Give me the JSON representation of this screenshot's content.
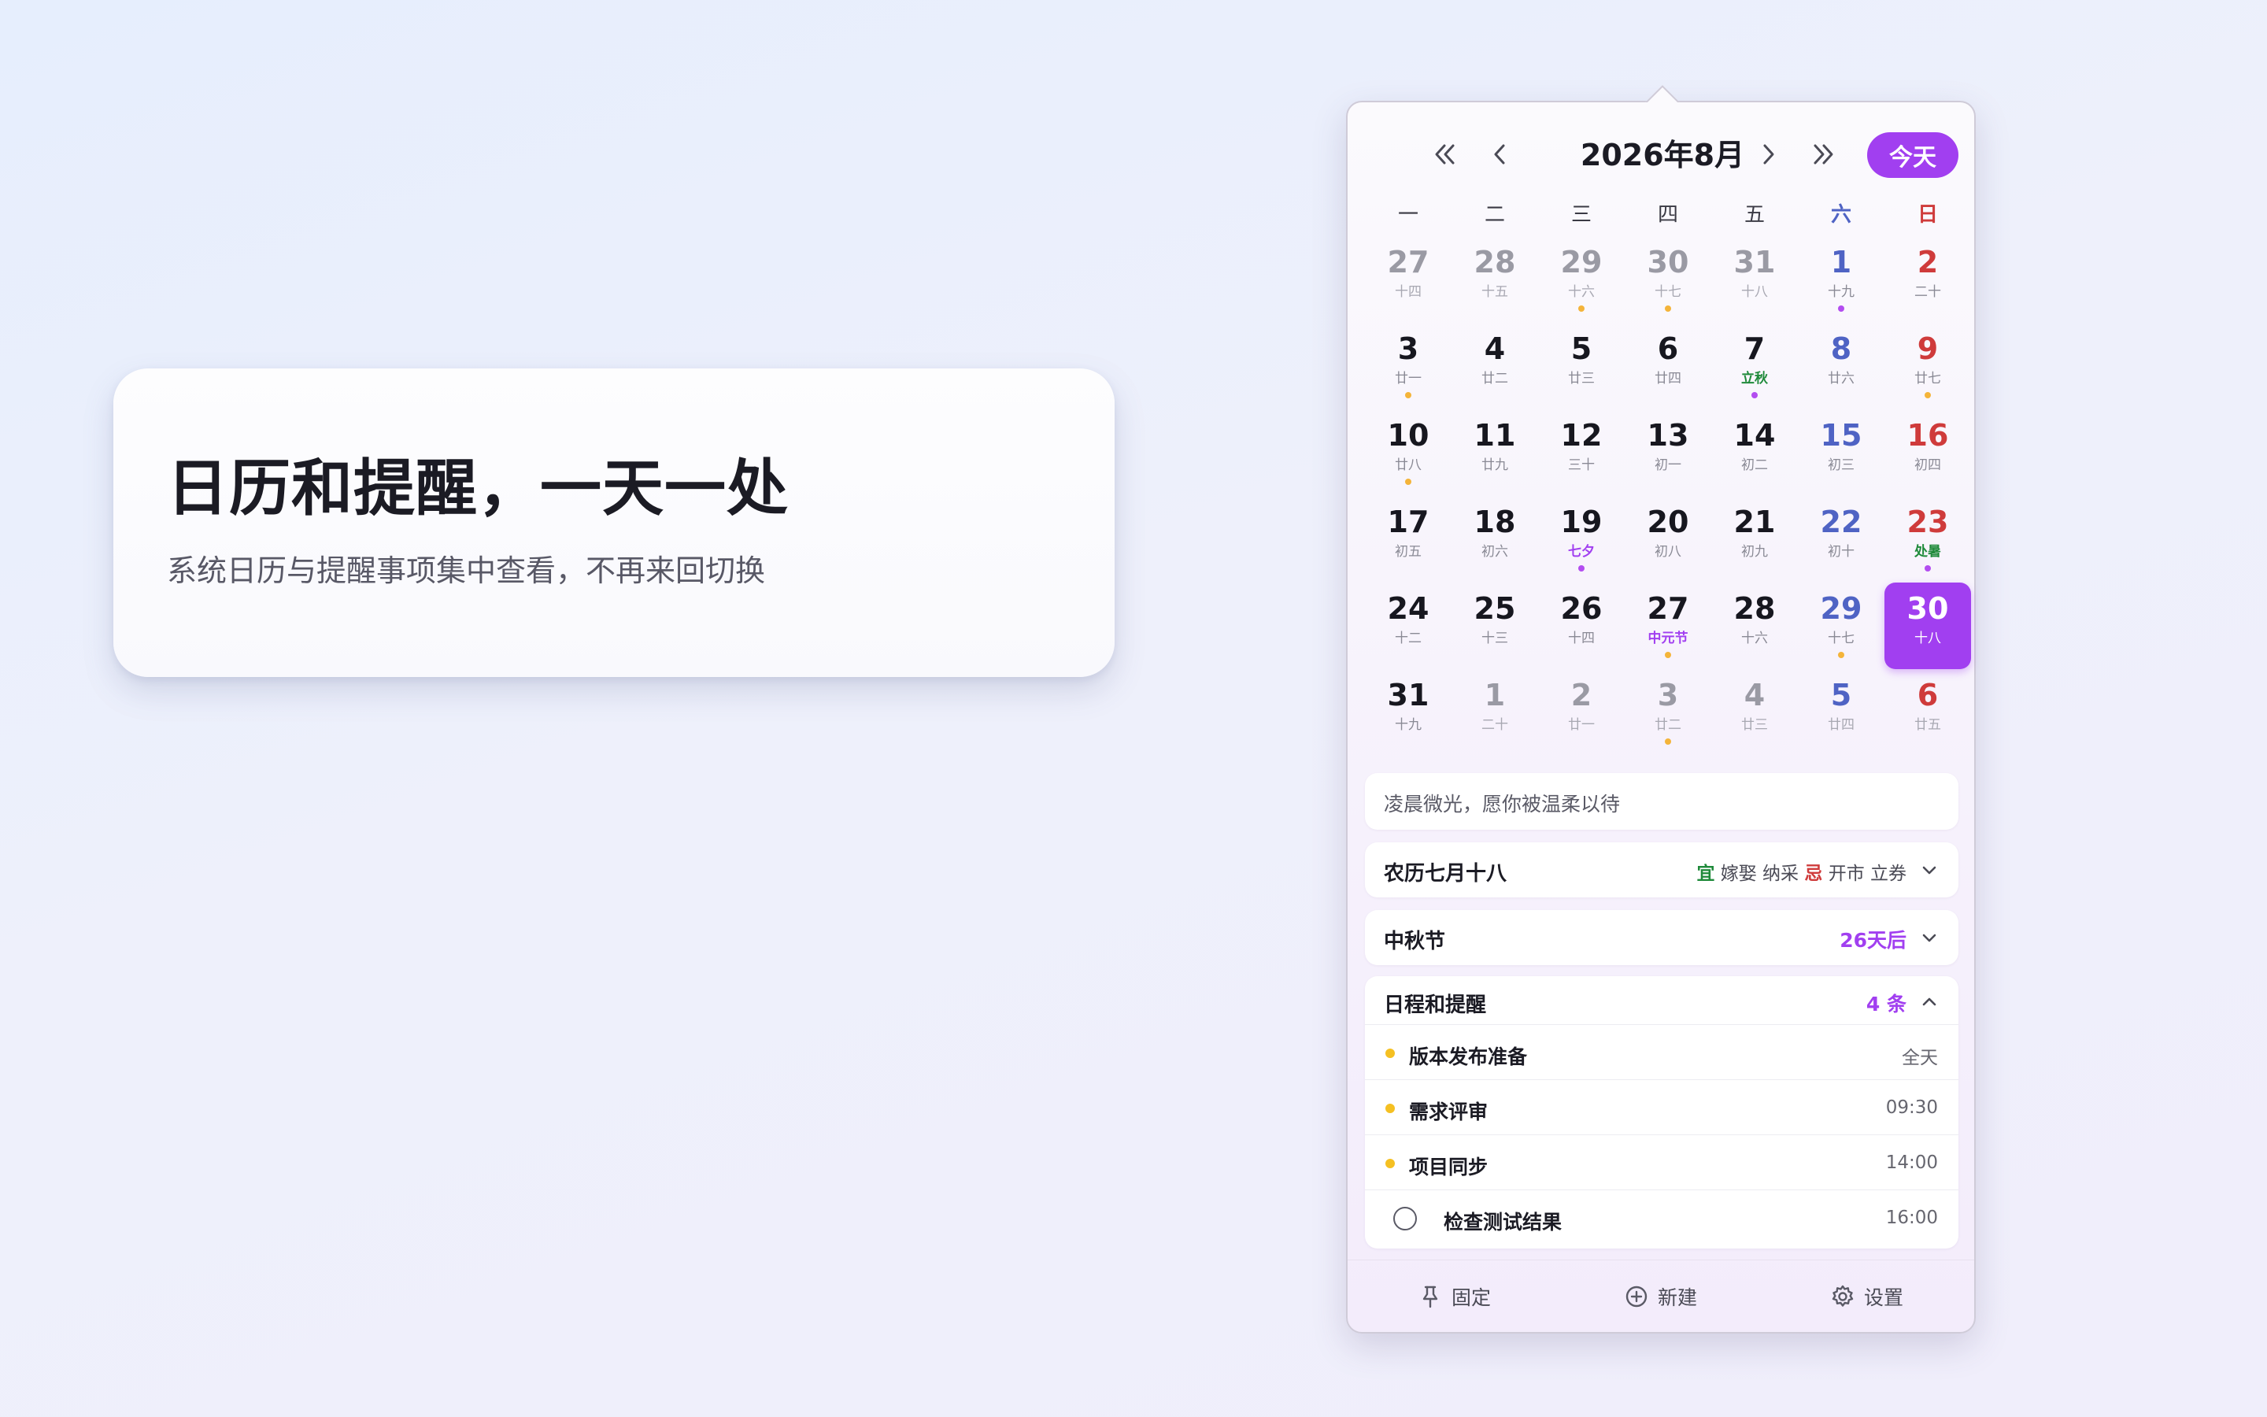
{
  "hero": {
    "title": "日历和提醒，一天一处",
    "subtitle": "系统日历与提醒事项集中查看，不再来回切换"
  },
  "calendar": {
    "title": "2026年8月",
    "today_label": "今天",
    "weekdays": [
      "一",
      "二",
      "三",
      "四",
      "五",
      "六",
      "日"
    ],
    "days": [
      {
        "d": "27",
        "l": "十四",
        "other": true
      },
      {
        "d": "28",
        "l": "十五",
        "other": true
      },
      {
        "d": "29",
        "l": "十六",
        "other": true,
        "dot": "o"
      },
      {
        "d": "30",
        "l": "十七",
        "other": true,
        "dot": "o"
      },
      {
        "d": "31",
        "l": "十八",
        "other": true
      },
      {
        "d": "1",
        "l": "十九",
        "dot": "p"
      },
      {
        "d": "2",
        "l": "二十"
      },
      {
        "d": "3",
        "l": "廿一",
        "dot": "o"
      },
      {
        "d": "4",
        "l": "廿二"
      },
      {
        "d": "5",
        "l": "廿三"
      },
      {
        "d": "6",
        "l": "廿四"
      },
      {
        "d": "7",
        "l": "立秋",
        "lt": "term",
        "dot": "p"
      },
      {
        "d": "8",
        "l": "廿六"
      },
      {
        "d": "9",
        "l": "廿七",
        "dot": "o"
      },
      {
        "d": "10",
        "l": "廿八",
        "dot": "o"
      },
      {
        "d": "11",
        "l": "廿九"
      },
      {
        "d": "12",
        "l": "三十"
      },
      {
        "d": "13",
        "l": "初一"
      },
      {
        "d": "14",
        "l": "初二"
      },
      {
        "d": "15",
        "l": "初三"
      },
      {
        "d": "16",
        "l": "初四"
      },
      {
        "d": "17",
        "l": "初五"
      },
      {
        "d": "18",
        "l": "初六"
      },
      {
        "d": "19",
        "l": "七夕",
        "lt": "fest",
        "dot": "p"
      },
      {
        "d": "20",
        "l": "初八"
      },
      {
        "d": "21",
        "l": "初九"
      },
      {
        "d": "22",
        "l": "初十"
      },
      {
        "d": "23",
        "l": "处暑",
        "lt": "term",
        "dot": "p"
      },
      {
        "d": "24",
        "l": "十二"
      },
      {
        "d": "25",
        "l": "十三"
      },
      {
        "d": "26",
        "l": "十四"
      },
      {
        "d": "27",
        "l": "中元节",
        "lt": "fest",
        "dot": "o"
      },
      {
        "d": "28",
        "l": "十六"
      },
      {
        "d": "29",
        "l": "十七",
        "dot": "o"
      },
      {
        "d": "30",
        "l": "十八",
        "selected": true
      },
      {
        "d": "31",
        "l": "十九"
      },
      {
        "d": "1",
        "l": "二十",
        "other": true
      },
      {
        "d": "2",
        "l": "廿一",
        "other": true
      },
      {
        "d": "3",
        "l": "廿二",
        "other": true,
        "dot": "o"
      },
      {
        "d": "4",
        "l": "廿三",
        "other": true
      },
      {
        "d": "5",
        "l": "廿四",
        "other": true
      },
      {
        "d": "6",
        "l": "廿五",
        "other": true
      }
    ]
  },
  "quote": "凌晨微光，愿你被温柔以待",
  "lunar": {
    "label": "农历七月十八",
    "yi_label": "宜",
    "yi_items": "嫁娶 纳采",
    "ji_label": "忌",
    "ji_items": "开市 立券"
  },
  "festival": {
    "label": "中秋节",
    "countdown": "26天后"
  },
  "schedule": {
    "label": "日程和提醒",
    "count": "4 条",
    "events": [
      {
        "name": "版本发布准备",
        "time": "全天"
      },
      {
        "name": "需求评审",
        "time": "09:30"
      },
      {
        "name": "项目同步",
        "time": "14:00"
      }
    ],
    "reminder": {
      "name": "检查测试结果",
      "time": "16:00"
    }
  },
  "footer": {
    "pin": "固定",
    "new": "新建",
    "settings": "设置"
  },
  "colors": {
    "accent": "#a13ff0",
    "saturday": "#4f63c4",
    "sunday": "#cf3b3b",
    "solar_term": "#1f8a3a",
    "event_dot": "#f5c022"
  }
}
